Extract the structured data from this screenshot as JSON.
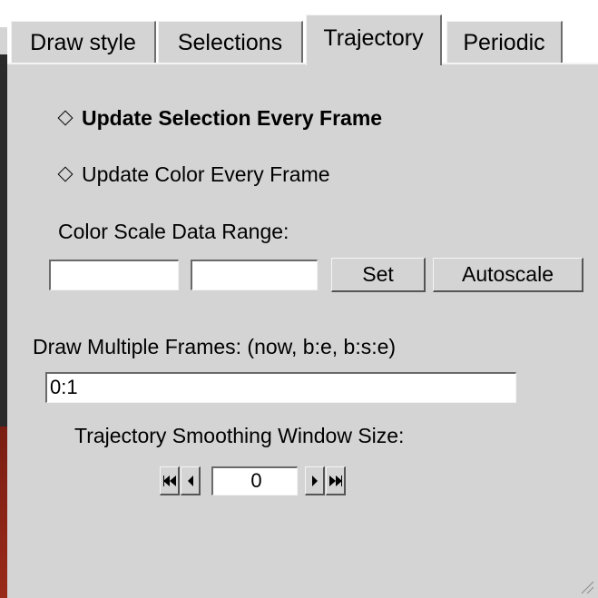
{
  "tabs": {
    "draw_style": "Draw style",
    "selections": "Selections",
    "trajectory": "Trajectory",
    "periodic": "Periodic"
  },
  "active_tab": "Trajectory",
  "options": {
    "update_selection": "Update Selection Every Frame",
    "update_color": "Update Color Every Frame"
  },
  "color_scale": {
    "label": "Color Scale Data Range:",
    "min_value": "",
    "max_value": "",
    "set_label": "Set",
    "autoscale_label": "Autoscale"
  },
  "multiple_frames": {
    "label": "Draw Multiple Frames: (now, b:e, b:s:e)",
    "value": "0:1"
  },
  "smoothing": {
    "label": "Trajectory Smoothing Window Size:",
    "value": "0"
  },
  "icons": {
    "first": "double-left-arrow-icon",
    "prev": "left-arrow-icon",
    "next": "right-arrow-icon",
    "last": "double-right-arrow-icon",
    "radio": "diamond-radio-icon",
    "resize": "resize-grip-icon"
  },
  "colors": {
    "panel_bg": "#d4d4d4",
    "entry_bg": "#ffffff"
  }
}
